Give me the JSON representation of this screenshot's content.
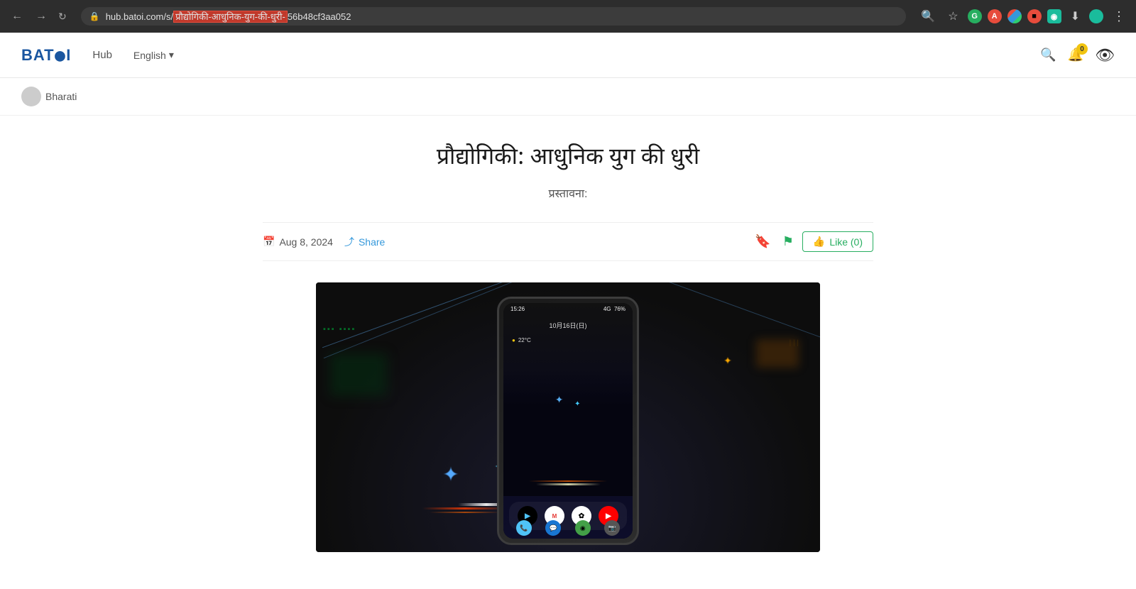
{
  "browser": {
    "url_prefix": "hub.batoi.com/s/",
    "url_highlighted": "प्रौद्योगिकी-आधुनिक-युग-की-धुरी-",
    "url_suffix": "56b48cf3aa052",
    "back_btn": "←",
    "forward_btn": "→",
    "refresh_btn": "↻"
  },
  "nav": {
    "logo": "BATOI",
    "hub_label": "Hub",
    "lang_label": "English",
    "lang_chevron": "▾",
    "badge_count": "0"
  },
  "breadcrumb": {
    "user_name": "Bharati"
  },
  "post": {
    "title": "प्रौद्योगिकी: आधुनिक युग की धुरी",
    "subtitle": "प्रस्तावना:",
    "date": "Aug 8, 2024",
    "share_label": "Share",
    "like_label": "Like (0)",
    "calendar_icon": "📅",
    "share_icon": "⤴",
    "bookmark_icon": "🔖",
    "flag_icon": "⚑",
    "like_icon": "👍"
  },
  "phone": {
    "time": "15:26",
    "signal": "4G",
    "battery": "76%",
    "date_text": "10月16日(日)",
    "weather_temp": "22°C",
    "apps": [
      "Play ストア",
      "Gmail",
      "Photos",
      "YouTube"
    ]
  }
}
